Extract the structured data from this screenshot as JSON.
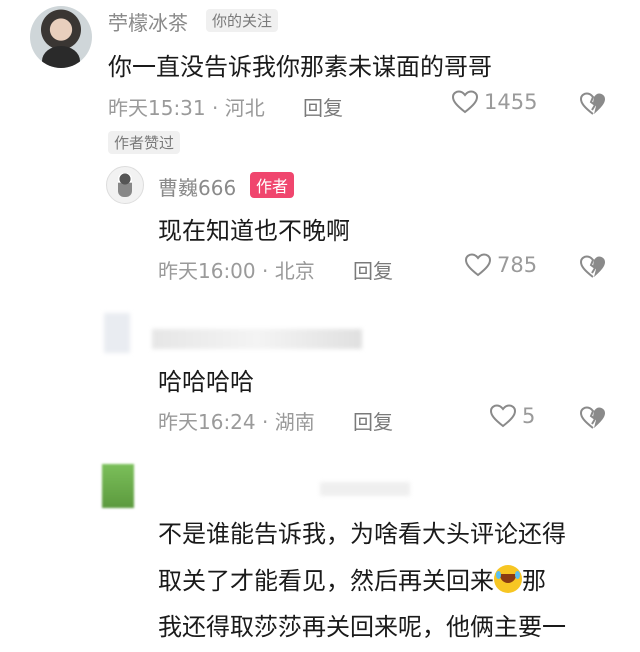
{
  "comments": [
    {
      "username": "苧檬冰茶",
      "badge": "你的关注",
      "text": "你一直没告诉我你那素未谋面的哥哥",
      "meta": "昨天15:31 · 河北",
      "reply_label": "回复",
      "likes": "1455",
      "author_liked": "作者赞过"
    },
    {
      "username": "曹巍666",
      "badge": "作者",
      "text": "现在知道也不晚啊",
      "meta": "昨天16:00 · 北京",
      "reply_label": "回复",
      "likes": "785"
    },
    {
      "text": "哈哈哈哈",
      "meta": "昨天16:24 · 湖南",
      "reply_label": "回复",
      "likes": "5"
    },
    {
      "text_lines": [
        "不是谁能告诉我，为啥看大头评论还得",
        "取关了才能看见，然后再关回来",
        "那",
        "我还得取莎莎再关回来呢，他俩主要一"
      ]
    }
  ],
  "colors": {
    "author_badge": "#f0466e",
    "meta_text": "#9a9a9a",
    "body_text": "#1a1a1a"
  },
  "icons": [
    "heart-icon",
    "broken-heart-icon",
    "laughing-tears-emoji"
  ]
}
